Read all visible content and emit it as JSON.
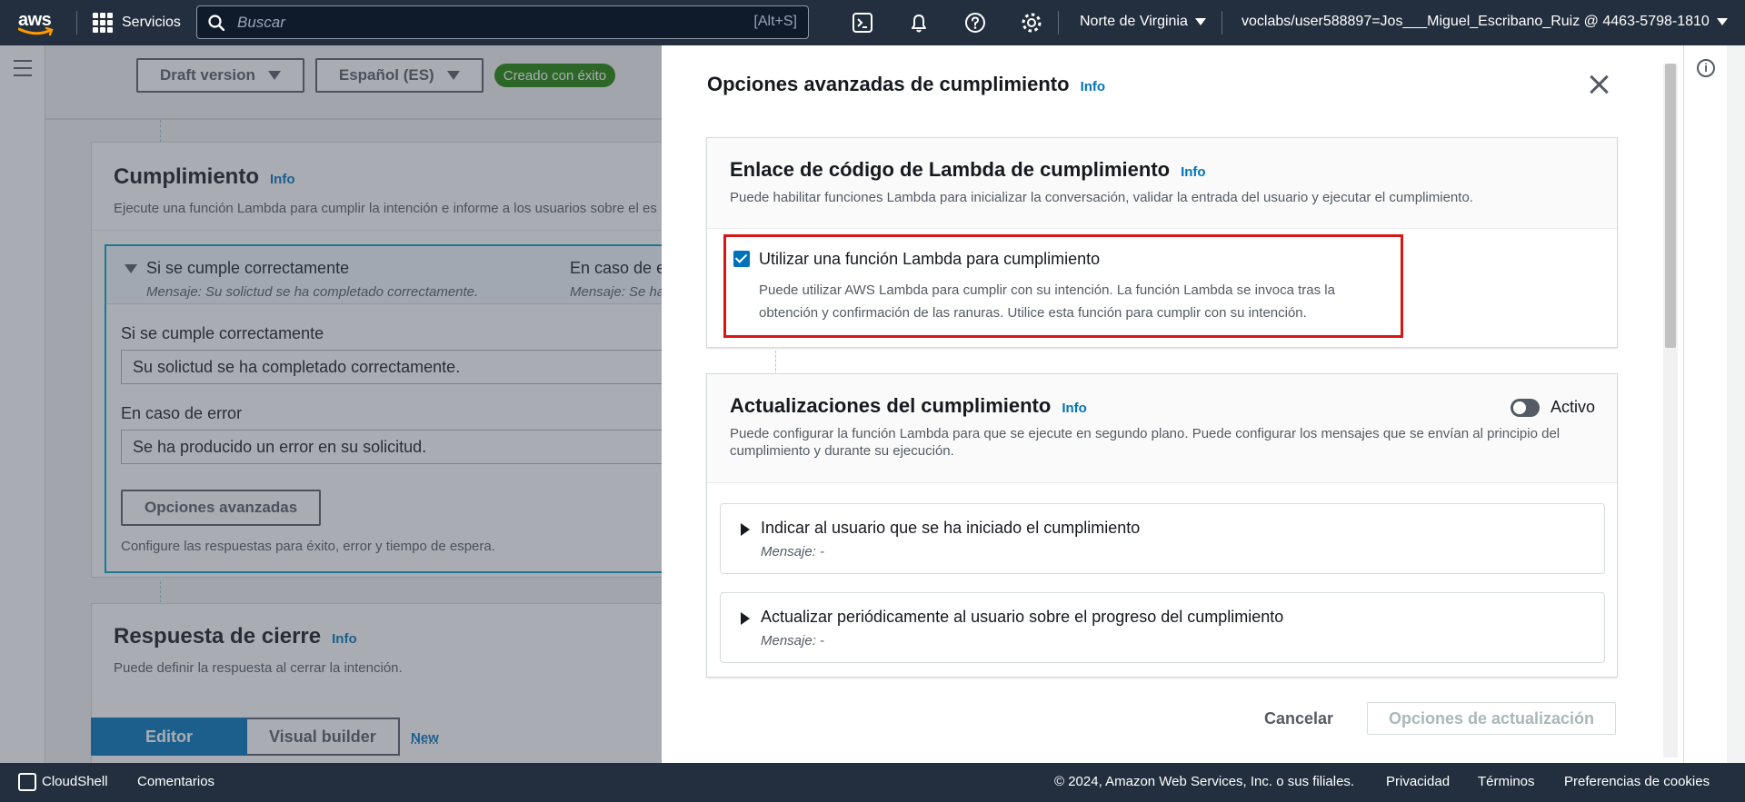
{
  "topnav": {
    "logo": "aws",
    "services_label": "Servicios",
    "search_placeholder": "Buscar",
    "search_shortcut": "[Alt+S]",
    "icons": [
      "cloudshell-icon",
      "bell-icon",
      "help-icon",
      "gear-icon"
    ],
    "region": "Norte de Virginia",
    "account": "voclabs/user588897=Jos___Miguel_Escribano_Ruiz @ 4463-5798-1810"
  },
  "background": {
    "version_label": "Draft version",
    "language_label": "Español (ES)",
    "status_badge": "Creado con éxito",
    "fulfillment": {
      "title": "Cumplimiento",
      "info": "Info",
      "description": "Ejecute una función Lambda para cumplir la intención e informe a los usuarios sobre el es",
      "success_header": "Si se cumple correctamente",
      "success_message": "Mensaje: Su solictud se ha completado correctamente.",
      "error_header": "En caso de er",
      "error_message": "Mensaje: Se ha",
      "success_label": "Si se cumple correctamente",
      "success_value": "Su solictud se ha completado correctamente.",
      "error_label": "En caso de error",
      "error_value": "Se ha producido un error en su solicitud.",
      "advanced_button": "Opciones avanzadas",
      "advanced_hint": "Configure las respuestas para éxito, error y tiempo de espera."
    },
    "closing": {
      "title": "Respuesta de cierre",
      "info": "Info",
      "description": "Puede definir la respuesta al cerrar la intención."
    },
    "tabs": {
      "editor": "Editor",
      "visual": "Visual builder",
      "new_label": "New"
    }
  },
  "modal": {
    "title": "Opciones avanzadas de cumplimiento",
    "info": "Info",
    "lambda_card": {
      "title": "Enlace de código de Lambda de cumplimiento",
      "info": "Info",
      "description": "Puede habilitar funciones Lambda para inicializar la conversación, validar la entrada del usuario y ejecutar el cumplimiento.",
      "checkbox_label": "Utilizar una función Lambda para cumplimiento",
      "checkbox_checked": true,
      "checkbox_desc_1": "Puede utilizar AWS Lambda para cumplir con su intención. La función Lambda se invoca tras la",
      "checkbox_desc_2": "obtención y confirmación de las ranuras. Utilice esta función para cumplir con su intención."
    },
    "updates_card": {
      "title": "Actualizaciones del cumplimiento",
      "info": "Info",
      "toggle_label": "Activo",
      "toggle_on": false,
      "description": "Puede configurar la función Lambda para que se ejecute en segundo plano. Puede configurar los mensajes que se envían al principio del cumplimiento y durante su ejecución.",
      "sections": [
        {
          "title": "Indicar al usuario que se ha iniciado el cumplimiento",
          "message": "Mensaje: -"
        },
        {
          "title": "Actualizar periódicamente al usuario sobre el progreso del cumplimiento",
          "message": "Mensaje: -"
        }
      ]
    },
    "cancel_label": "Cancelar",
    "update_label": "Opciones de actualización"
  },
  "footer": {
    "cloudshell": "CloudShell",
    "feedback": "Comentarios",
    "copyright": "© 2024, Amazon Web Services, Inc. o sus filiales.",
    "privacy": "Privacidad",
    "terms": "Términos",
    "cookies": "Preferencias de cookies"
  },
  "colors": {
    "nav_bg": "#232f3e",
    "link": "#0073bb",
    "success": "#1d8102",
    "highlight": "#d91515"
  }
}
